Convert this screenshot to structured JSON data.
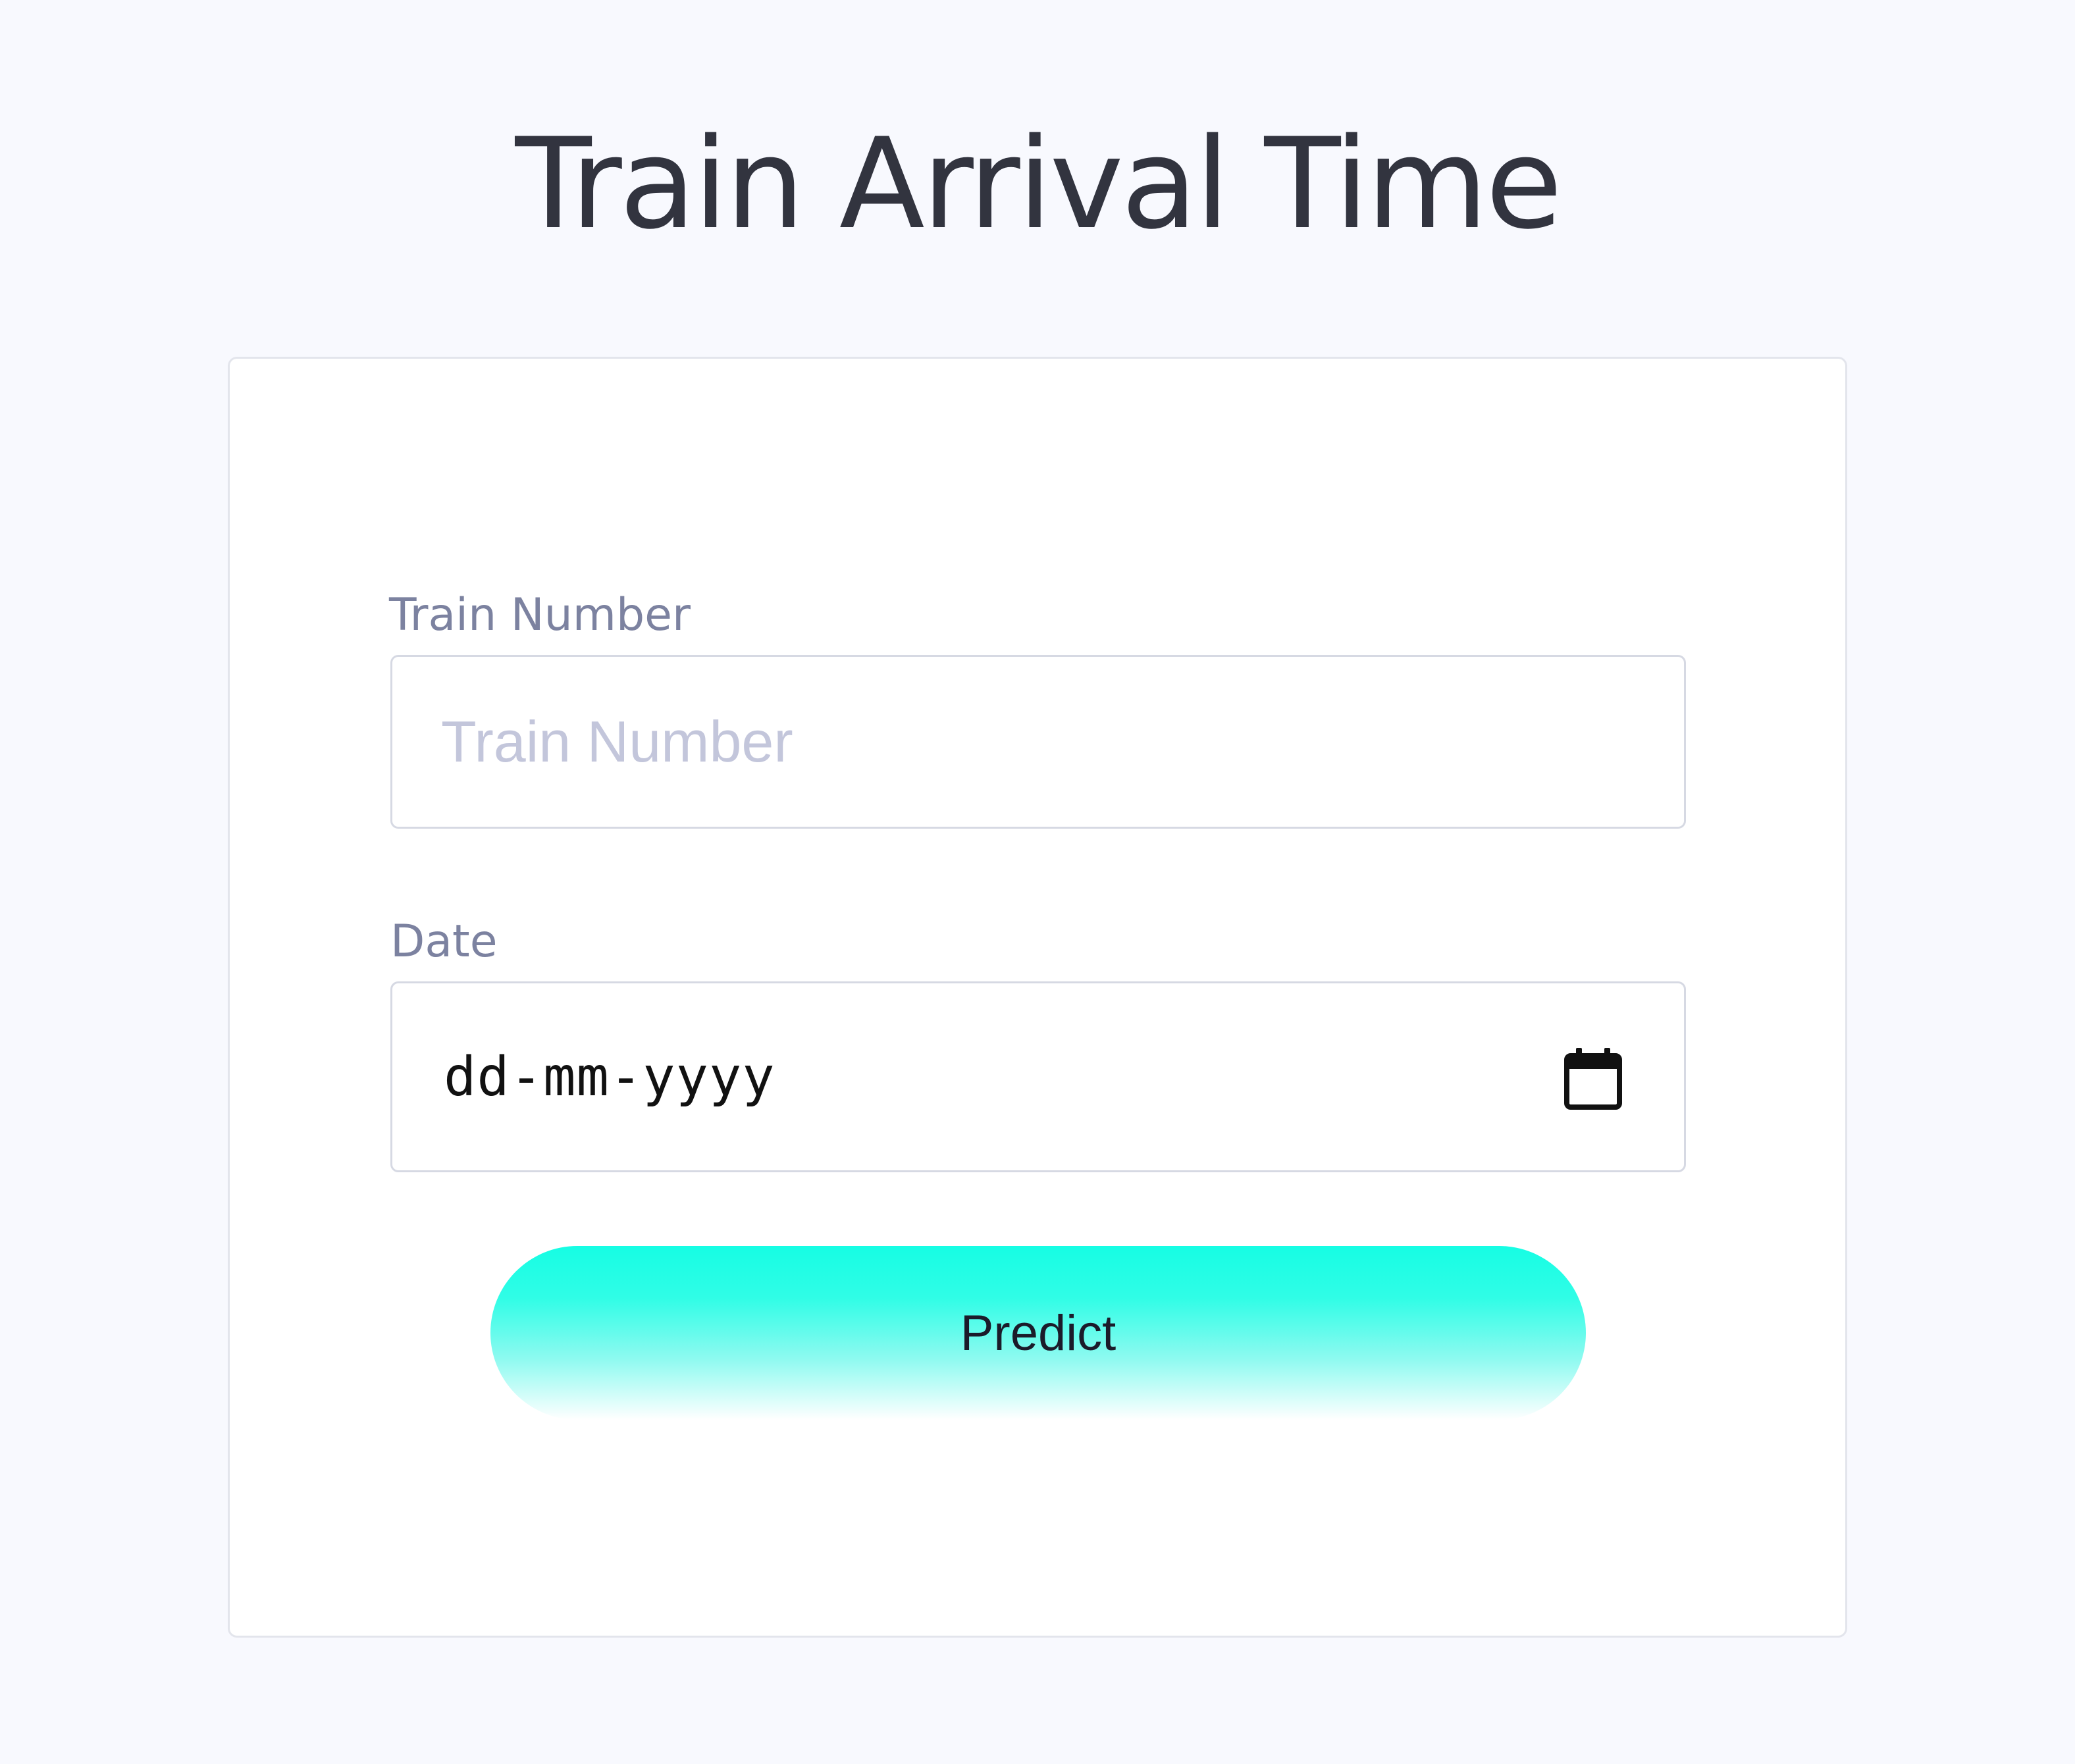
{
  "page": {
    "title": "Train Arrival Time"
  },
  "form": {
    "train_number": {
      "label": "Train Number",
      "placeholder": "Train Number",
      "value": ""
    },
    "date": {
      "label": "Date",
      "placeholder": "dd-mm-yyyy",
      "icon": "calendar-icon"
    },
    "predict_button": {
      "label": "Predict"
    }
  },
  "colors": {
    "page_background": "#f8f9fe",
    "card_background": "#ffffff",
    "title_text": "#32343f",
    "label_text": "#7c82a0",
    "placeholder_text": "#c3c6db",
    "button_gradient_top": "#16fde4",
    "button_gradient_bottom": "#ffffff"
  }
}
